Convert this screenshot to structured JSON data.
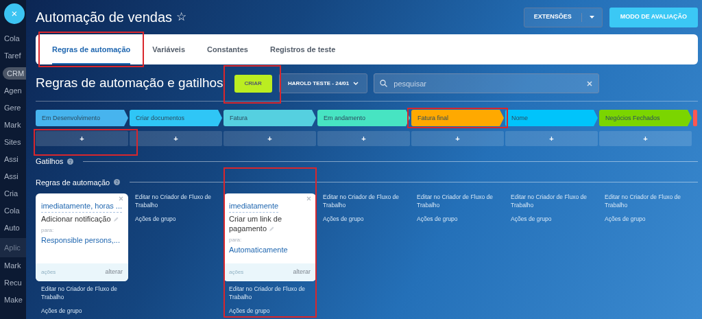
{
  "sidebar": {
    "close_button": "×",
    "items": [
      {
        "label": "Cola",
        "kind": "link"
      },
      {
        "label": "Taref",
        "kind": "link"
      },
      {
        "label": "CRM",
        "kind": "pill"
      },
      {
        "label": "Agen",
        "kind": "link"
      },
      {
        "label": "Gere",
        "kind": "link"
      },
      {
        "label": "Mark",
        "kind": "link"
      },
      {
        "label": "Sites",
        "kind": "link"
      },
      {
        "label": "Assi",
        "kind": "link"
      },
      {
        "label": "Assi",
        "kind": "link"
      },
      {
        "label": "Cria",
        "kind": "link"
      },
      {
        "label": "Cola",
        "kind": "link"
      },
      {
        "label": "Auto",
        "kind": "link"
      },
      {
        "label": "Aplic",
        "kind": "group"
      },
      {
        "label": "Mark",
        "kind": "link"
      },
      {
        "label": "Recu",
        "kind": "link"
      },
      {
        "label": "Make",
        "kind": "link"
      }
    ]
  },
  "header": {
    "title": "Automação de vendas",
    "star": "☆",
    "buttons": [
      {
        "label": "EXTENSÕES",
        "kind": "split"
      },
      {
        "label": "MODO DE AVALIAÇÃO",
        "kind": "primary"
      }
    ]
  },
  "tabs": [
    {
      "label": "Regras de automação",
      "selected": true,
      "highlighted": true
    },
    {
      "label": "Variáveis",
      "selected": false,
      "highlighted": false
    },
    {
      "label": "Constantes",
      "selected": false,
      "highlighted": false
    },
    {
      "label": "Registros de teste",
      "selected": false,
      "highlighted": false
    }
  ],
  "toolbar": {
    "heading": "Regras de automação e gatilhos",
    "create_button": {
      "label": "CRIAR",
      "highlighted": true
    },
    "filter": "HAROLD TESTE - 24/01",
    "search": {
      "placeholder": "pesquisar"
    }
  },
  "stages": [
    {
      "name": "Em Desenvolvimento",
      "color": "#47b4ee",
      "add_label": "+",
      "label_highlighted": false,
      "add_highlighted": true
    },
    {
      "name": "Criar documentos",
      "color": "#2fc6f6",
      "add_label": "+",
      "label_highlighted": false,
      "add_highlighted": false
    },
    {
      "name": "Fatura",
      "color": "#55d0e0",
      "add_label": "+",
      "label_highlighted": false,
      "add_highlighted": false
    },
    {
      "name": "Em andamento",
      "color": "#47e4c2",
      "add_label": "+",
      "label_highlighted": false,
      "add_highlighted": false
    },
    {
      "name": "Fatura final",
      "color": "#ffa900",
      "add_label": "+",
      "label_highlighted": true,
      "add_highlighted": false
    },
    {
      "name": "Nome",
      "color": "#00c4fb",
      "add_label": "+",
      "label_highlighted": false,
      "add_highlighted": false
    },
    {
      "name": "Negócios Fechados",
      "color": "#7bd500",
      "add_label": "+",
      "label_highlighted": false,
      "add_highlighted": false
    },
    {
      "color": "#ff5752",
      "kind": "cut"
    }
  ],
  "sections": [
    {
      "title": "Gatilhos"
    },
    {
      "title": "Regras de automação"
    }
  ],
  "columns": [
    {
      "highlighted": false,
      "rules": [
        {
          "trigger": "imediatamente, horas ...",
          "action": "Adicionar notificação",
          "to_label": "para:",
          "target": "Responsible persons,...",
          "actions_label": "ações",
          "change_label": "alterar"
        }
      ],
      "links": [
        "Editar no Criador de Fluxo de Trabalho",
        "Ações de grupo"
      ]
    },
    {
      "highlighted": false,
      "links": [
        "Editar no Criador de Fluxo de Trabalho",
        "Ações de grupo"
      ]
    },
    {
      "highlighted": true,
      "rules": [
        {
          "trigger": "imediatamente",
          "action": "Criar um link de pagamento",
          "to_label": "para:",
          "target": "Automaticamente",
          "actions_label": "ações",
          "change_label": "alterar"
        }
      ],
      "links": [
        "Editar no Criador de Fluxo de Trabalho",
        "Ações de grupo"
      ]
    },
    {
      "highlighted": false,
      "links": [
        "Editar no Criador de Fluxo de Trabalho",
        "Ações de grupo"
      ]
    },
    {
      "highlighted": false,
      "links": [
        "Editar no Criador de Fluxo de Trabalho",
        "Ações de grupo"
      ]
    },
    {
      "highlighted": false,
      "links": [
        "Editar no Criador de Fluxo de Trabalho",
        "Ações de grupo"
      ]
    },
    {
      "highlighted": false,
      "links": [
        "Editar no Criador de Fluxo de Trabalho",
        "Ações de grupo"
      ]
    }
  ]
}
